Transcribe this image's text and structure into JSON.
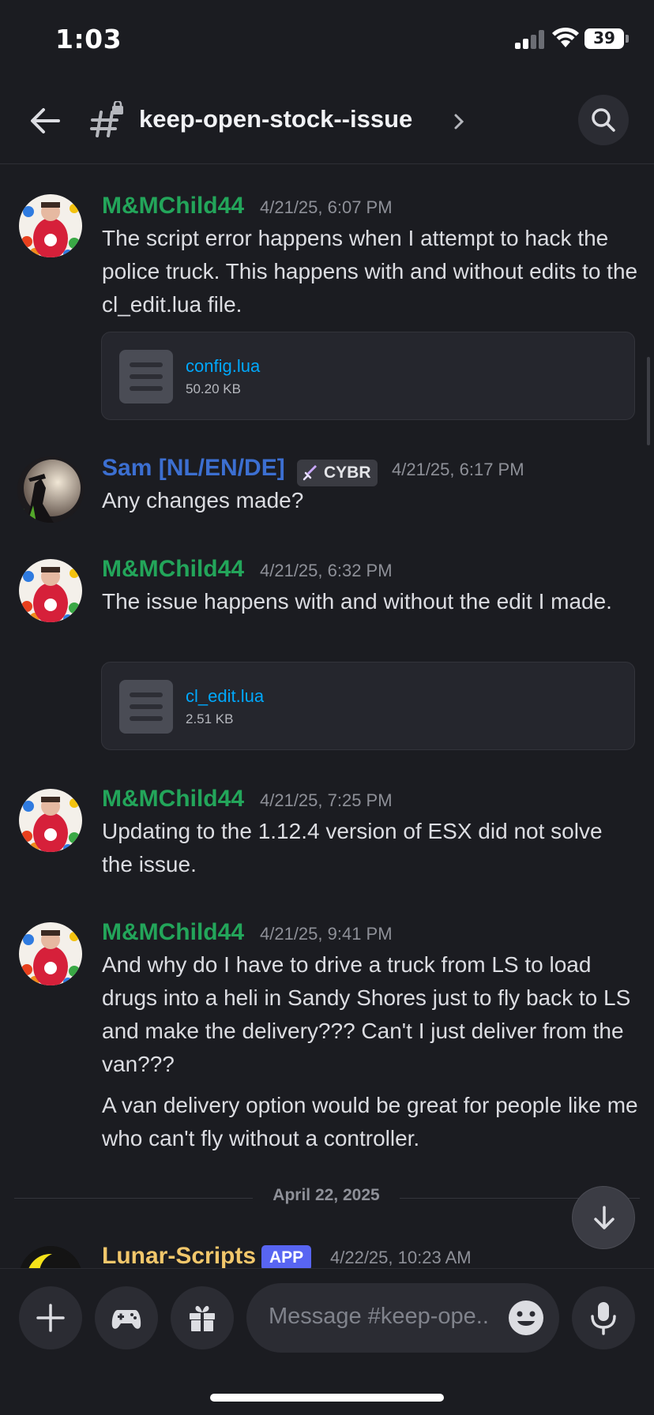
{
  "status_bar": {
    "time": "1:03",
    "battery": "39"
  },
  "header": {
    "channel_name": "keep-open-stock--issue"
  },
  "messages": [
    {
      "author": "M&MChild44",
      "author_color": "#23a55a",
      "timestamp": "4/21/25, 6:07 PM",
      "text": "The script error happens when I attempt to hack the police truck. This happens with and without edits to the cl_edit.lua file.",
      "attachment": {
        "name": "config.lua",
        "size": "50.20 KB"
      }
    },
    {
      "author": "Sam [NL/EN/DE]",
      "author_color": "#3c6fd1",
      "role_badge": "CYBR",
      "timestamp": "4/21/25, 6:17 PM",
      "text": "Any changes made?"
    },
    {
      "author": "M&MChild44",
      "author_color": "#23a55a",
      "timestamp": "4/21/25, 6:32 PM",
      "text": "The issue happens with and without the edit I made.",
      "attachment": {
        "name": "cl_edit.lua",
        "size": "2.51 KB"
      }
    },
    {
      "author": "M&MChild44",
      "author_color": "#23a55a",
      "timestamp": "4/21/25, 7:25 PM",
      "text": "Updating to the 1.12.4 version of ESX did not solve the issue."
    },
    {
      "author": "M&MChild44",
      "author_color": "#23a55a",
      "timestamp": "4/21/25, 9:41 PM",
      "text": "And why do I have to drive a truck from LS to load drugs into a heli in Sandy Shores just to fly back to LS and make the delivery??? Can't I just deliver from the van???",
      "text2": "A van delivery option would be great for people like me who can't fly without a controller."
    },
    {
      "author": "Lunar-Scripts",
      "author_color": "#f2c76b",
      "app_badge": "APP",
      "timestamp": "4/22/25, 10:23 AM"
    }
  ],
  "date_divider": "April 22, 2025",
  "composer": {
    "placeholder": "Message #keep-ope.."
  }
}
